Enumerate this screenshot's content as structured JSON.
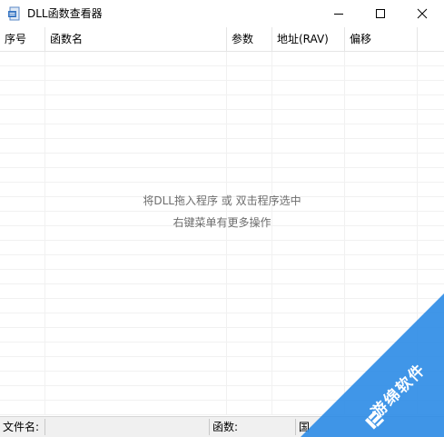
{
  "window": {
    "title": "DLL函数查看器",
    "icon": "dll-document-icon",
    "controls": [
      "minimize-icon",
      "maximize-icon",
      "close-icon"
    ]
  },
  "table": {
    "columns": [
      "序号",
      "函数名",
      "参数",
      "地址(RAV)",
      "偏移"
    ]
  },
  "empty_state": {
    "line1": "将DLL拖入程序 或 双击程序选中",
    "line2": "右键菜单有更多操作"
  },
  "statusbar": {
    "file_label": "文件名:",
    "func_label": "函数:",
    "third_label_partial": "国"
  },
  "watermark": {
    "text": "游绵软件",
    "color": "#2b8be6"
  }
}
